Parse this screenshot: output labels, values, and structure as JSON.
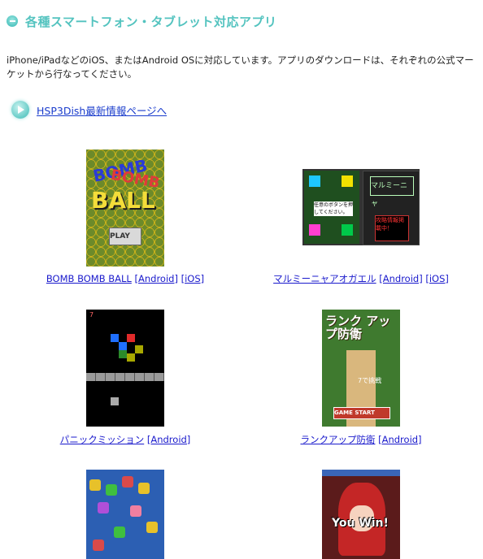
{
  "heading": "各種スマートフォン・タブレット対応アプリ",
  "description": "iPhone/iPadなどのiOS、またはAndroid OSに対応しています。アプリのダウンロードは、それぞれの公式マーケットから行なってください。",
  "hsp_link": "HSP3Dish最新情報ページへ",
  "apps": [
    {
      "name": "BOMB BOMB BALL",
      "links": [
        "[Android]",
        "[iOS]"
      ],
      "art_text": [
        "BOMB",
        "BOMB",
        "BALL",
        "PLAY"
      ]
    },
    {
      "name": "マルミーニャアオガエル",
      "links": [
        "[Android]",
        "[iOS]"
      ],
      "art_text": [
        "任意のボタンを押してください。",
        "マルミーニャ",
        "攻略情報掲載中！"
      ]
    },
    {
      "name": "パニックミッション",
      "links": [
        "[Android]"
      ],
      "art_text": [
        "7"
      ]
    },
    {
      "name": "ランクアップ防衛",
      "links": [
        "[Android]"
      ],
      "art_text": [
        "ランク アップ防衛",
        "GAME START",
        "7で挑戦"
      ]
    },
    {
      "name": "",
      "links": [],
      "art_text": []
    },
    {
      "name": "",
      "links": [],
      "art_text": [
        "You Win!"
      ]
    }
  ],
  "colors": {
    "accent": "#53c3bf",
    "link": "#1a1acc"
  }
}
